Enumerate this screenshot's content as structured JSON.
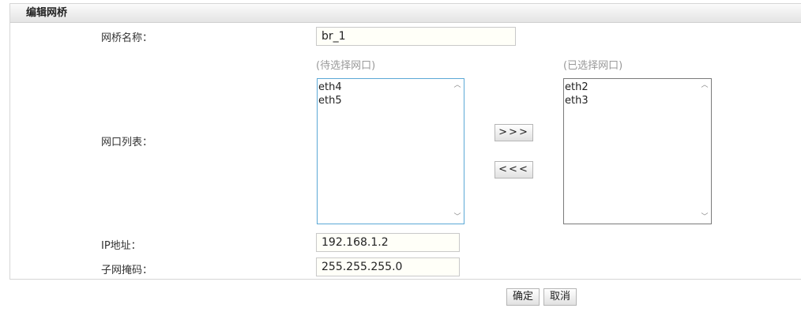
{
  "panel": {
    "title": "编辑网桥"
  },
  "form": {
    "bridge_name_label": "网桥名称：",
    "bridge_name_value": "br_1",
    "ports_label": "网口列表：",
    "available_caption": "(待选择网口)",
    "selected_caption": "(已选择网口)",
    "available_ports": [
      "eth4",
      "eth5"
    ],
    "selected_ports": [
      "eth2",
      "eth3"
    ],
    "add_button": ">>>",
    "remove_button": "<<<",
    "ip_label": "IP地址：",
    "ip_value": "192.168.1.2",
    "mask_label": "子网掩码：",
    "mask_value": "255.255.255.0"
  },
  "actions": {
    "confirm": "确定",
    "cancel": "取消"
  },
  "icons": {
    "scroll_up": "scroll-up-icon",
    "scroll_down": "scroll-down-icon"
  },
  "colors": {
    "active_list_border": "#5ba8d6",
    "list_border": "#7a7a7a",
    "input_bg": "#fffff8"
  }
}
